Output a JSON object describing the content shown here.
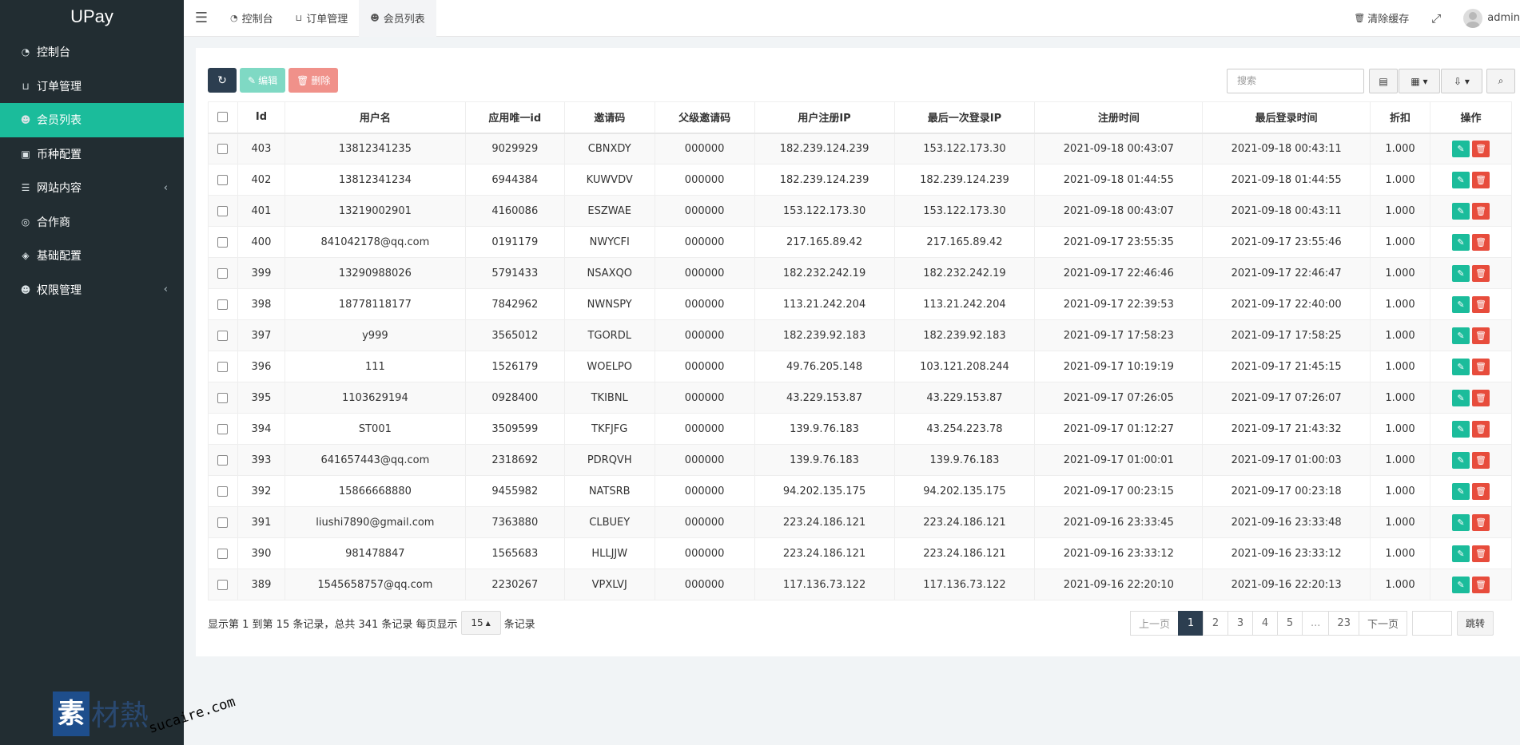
{
  "brand": "UPay",
  "sidebar": {
    "items": [
      {
        "icon": "dashboard-icon",
        "glyph": "◔",
        "label": "控制台",
        "active": false,
        "expandable": false
      },
      {
        "icon": "cart-icon",
        "glyph": "⊔",
        "label": "订单管理",
        "active": false,
        "expandable": false
      },
      {
        "icon": "users-icon",
        "glyph": "☻",
        "label": "会员列表",
        "active": true,
        "expandable": false
      },
      {
        "icon": "money-icon",
        "glyph": "▣",
        "label": "币种配置",
        "active": false,
        "expandable": false
      },
      {
        "icon": "list-icon",
        "glyph": "☰",
        "label": "网站内容",
        "active": false,
        "expandable": true
      },
      {
        "icon": "handshake-icon",
        "glyph": "◎",
        "label": "合作商",
        "active": false,
        "expandable": false
      },
      {
        "icon": "cube-icon",
        "glyph": "◈",
        "label": "基础配置",
        "active": false,
        "expandable": false
      },
      {
        "icon": "users-icon",
        "glyph": "☻",
        "label": "权限管理",
        "active": false,
        "expandable": true
      }
    ]
  },
  "header": {
    "tabs": [
      {
        "icon": "dashboard-icon",
        "glyph": "◔",
        "label": "控制台",
        "active": false
      },
      {
        "icon": "cart-icon",
        "glyph": "⊔",
        "label": "订单管理",
        "active": false
      },
      {
        "icon": "users-icon",
        "glyph": "☻",
        "label": "会员列表",
        "active": true
      }
    ],
    "clear_cache": "清除缓存",
    "user": "admin"
  },
  "toolbar": {
    "edit_label": "编辑",
    "delete_label": "删除",
    "search_placeholder": "搜索"
  },
  "table": {
    "columns": [
      "Id",
      "用户名",
      "应用唯一id",
      "邀请码",
      "父级邀请码",
      "用户注册IP",
      "最后一次登录IP",
      "注册时间",
      "最后登录时间",
      "折扣",
      "操作"
    ],
    "rows": [
      [
        "403",
        "13812341235",
        "9029929",
        "CBNXDY",
        "000000",
        "182.239.124.239",
        "153.122.173.30",
        "2021-09-18 00:43:07",
        "2021-09-18 00:43:11",
        "1.000"
      ],
      [
        "402",
        "13812341234",
        "6944384",
        "KUWVDV",
        "000000",
        "182.239.124.239",
        "182.239.124.239",
        "2021-09-18 01:44:55",
        "2021-09-18 01:44:55",
        "1.000"
      ],
      [
        "401",
        "13219002901",
        "4160086",
        "ESZWAE",
        "000000",
        "153.122.173.30",
        "153.122.173.30",
        "2021-09-18 00:43:07",
        "2021-09-18 00:43:11",
        "1.000"
      ],
      [
        "400",
        "841042178@qq.com",
        "0191179",
        "NWYCFI",
        "000000",
        "217.165.89.42",
        "217.165.89.42",
        "2021-09-17 23:55:35",
        "2021-09-17 23:55:46",
        "1.000"
      ],
      [
        "399",
        "13290988026",
        "5791433",
        "NSAXQO",
        "000000",
        "182.232.242.19",
        "182.232.242.19",
        "2021-09-17 22:46:46",
        "2021-09-17 22:46:47",
        "1.000"
      ],
      [
        "398",
        "18778118177",
        "7842962",
        "NWNSPY",
        "000000",
        "113.21.242.204",
        "113.21.242.204",
        "2021-09-17 22:39:53",
        "2021-09-17 22:40:00",
        "1.000"
      ],
      [
        "397",
        "y999",
        "3565012",
        "TGORDL",
        "000000",
        "182.239.92.183",
        "182.239.92.183",
        "2021-09-17 17:58:23",
        "2021-09-17 17:58:25",
        "1.000"
      ],
      [
        "396",
        "111",
        "1526179",
        "WOELPO",
        "000000",
        "49.76.205.148",
        "103.121.208.244",
        "2021-09-17 10:19:19",
        "2021-09-17 21:45:15",
        "1.000"
      ],
      [
        "395",
        "1103629194",
        "0928400",
        "TKIBNL",
        "000000",
        "43.229.153.87",
        "43.229.153.87",
        "2021-09-17 07:26:05",
        "2021-09-17 07:26:07",
        "1.000"
      ],
      [
        "394",
        "ST001",
        "3509599",
        "TKFJFG",
        "000000",
        "139.9.76.183",
        "43.254.223.78",
        "2021-09-17 01:12:27",
        "2021-09-17 21:43:32",
        "1.000"
      ],
      [
        "393",
        "641657443@qq.com",
        "2318692",
        "PDRQVH",
        "000000",
        "139.9.76.183",
        "139.9.76.183",
        "2021-09-17 01:00:01",
        "2021-09-17 01:00:03",
        "1.000"
      ],
      [
        "392",
        "15866668880",
        "9455982",
        "NATSRB",
        "000000",
        "94.202.135.175",
        "94.202.135.175",
        "2021-09-17 00:23:15",
        "2021-09-17 00:23:18",
        "1.000"
      ],
      [
        "391",
        "liushi7890@gmail.com",
        "7363880",
        "CLBUEY",
        "000000",
        "223.24.186.121",
        "223.24.186.121",
        "2021-09-16 23:33:45",
        "2021-09-16 23:33:48",
        "1.000"
      ],
      [
        "390",
        "981478847",
        "1565683",
        "HLLJJW",
        "000000",
        "223.24.186.121",
        "223.24.186.121",
        "2021-09-16 23:33:12",
        "2021-09-16 23:33:12",
        "1.000"
      ],
      [
        "389",
        "1545658757@qq.com",
        "2230267",
        "VPXLVJ",
        "000000",
        "117.136.73.122",
        "117.136.73.122",
        "2021-09-16 22:20:10",
        "2021-09-16 22:20:13",
        "1.000"
      ]
    ]
  },
  "footer": {
    "info_prefix": "显示第 1 到第 15 条记录，总共 341 条记录 每页显示",
    "page_size": "15",
    "info_suffix": "条记录",
    "prev": "上一页",
    "pages": [
      "1",
      "2",
      "3",
      "4",
      "5",
      "...",
      "23"
    ],
    "current_page": "1",
    "next": "下一页",
    "jump": "跳转"
  },
  "watermark": {
    "logo_char": "素",
    "text": "材熱",
    "url": "sucaire.com"
  },
  "colors": {
    "sidebar_bg": "#222d32",
    "accent": "#1bbc9b",
    "danger": "#e74c3c",
    "primary_dark": "#2c3e50"
  }
}
